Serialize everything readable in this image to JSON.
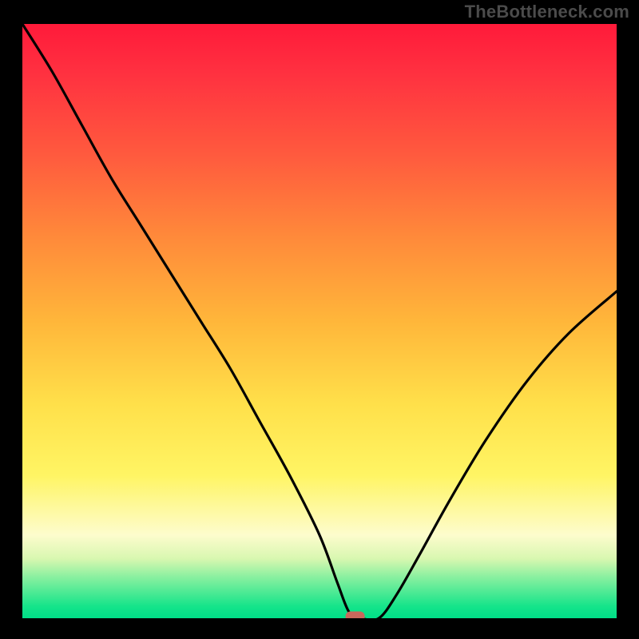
{
  "watermark": "TheBottleneck.com",
  "chart_data": {
    "type": "line",
    "title": "",
    "xlabel": "",
    "ylabel": "",
    "xlim": [
      0,
      100
    ],
    "ylim": [
      0,
      100
    ],
    "grid": false,
    "legend": false,
    "background_gradient": {
      "direction": "vertical",
      "stops": [
        {
          "pos": 0.0,
          "color": "#ff1a3a"
        },
        {
          "pos": 0.5,
          "color": "#ffb63a"
        },
        {
          "pos": 0.76,
          "color": "#fff564"
        },
        {
          "pos": 0.9,
          "color": "#d8f7b0"
        },
        {
          "pos": 1.0,
          "color": "#00df88"
        }
      ]
    },
    "series": [
      {
        "name": "curve",
        "x": [
          0,
          5,
          10,
          15,
          20,
          25,
          30,
          35,
          40,
          45,
          50,
          53,
          55,
          57,
          60,
          63,
          67,
          72,
          78,
          85,
          92,
          100
        ],
        "y": [
          100,
          92,
          83,
          74,
          66,
          58,
          50,
          42,
          33,
          24,
          14,
          6,
          1,
          0,
          0,
          4,
          11,
          20,
          30,
          40,
          48,
          55
        ]
      }
    ],
    "marker": {
      "label": "",
      "x": 56,
      "y": 0,
      "color": "#c9685c",
      "shape": "rounded-rect"
    }
  }
}
